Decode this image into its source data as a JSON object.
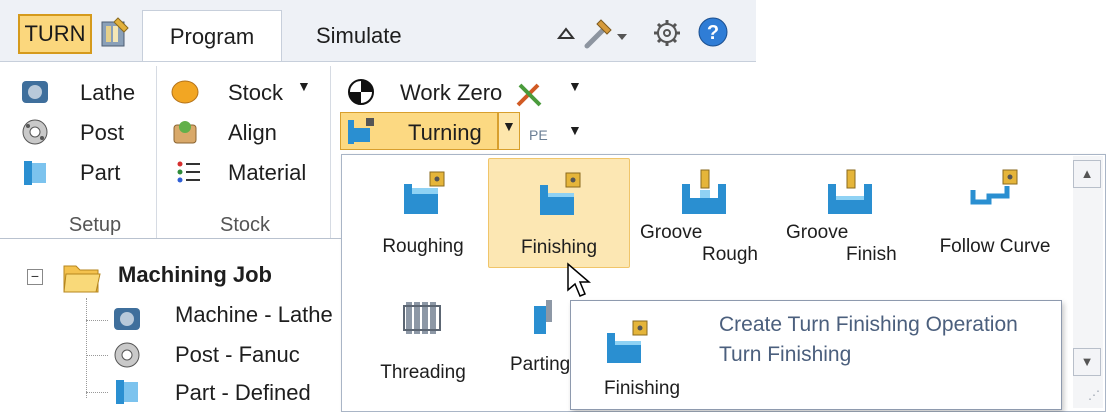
{
  "app": {
    "mode_button": "TURN"
  },
  "tabs": {
    "program": "Program",
    "simulate": "Simulate"
  },
  "setup_group": {
    "label": "Setup",
    "items": [
      "Lathe",
      "Post",
      "Part"
    ]
  },
  "stock_group": {
    "label": "Stock",
    "items": [
      "Stock",
      "Align",
      "Material"
    ]
  },
  "program_group": {
    "work_zero": "Work Zero",
    "turning": "Turning"
  },
  "tree": {
    "root": "Machining Job",
    "children": [
      "Machine - Lathe",
      "Post - Fanuc",
      "Part - Defined"
    ]
  },
  "gallery": {
    "items": [
      {
        "label": "Roughing",
        "icon": "turn-roughing-icon"
      },
      {
        "label": "Finishing",
        "icon": "turn-finishing-icon",
        "selected": true
      },
      {
        "label_line1": "Groove",
        "label_line2": "Rough",
        "icon": "groove-rough-icon"
      },
      {
        "label_line1": "Groove",
        "label_line2": "Finish",
        "icon": "groove-finish-icon"
      },
      {
        "label": "Follow Curve",
        "icon": "follow-curve-icon"
      },
      {
        "label": "Threading",
        "icon": "threading-icon"
      },
      {
        "label": "Parting",
        "icon": "parting-icon"
      }
    ]
  },
  "tooltip": {
    "title": "Create Turn Finishing Operation",
    "subtitle": "Turn Finishing",
    "icon_label": "Finishing"
  },
  "colors": {
    "selection": "#fce7b3",
    "turn_button": "#fbd77d",
    "tooltip_text": "#4b5f7d"
  }
}
